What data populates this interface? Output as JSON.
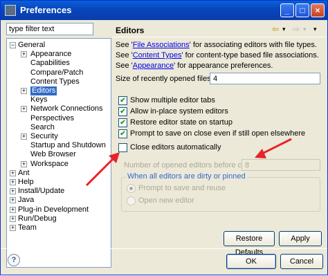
{
  "window": {
    "title": "Preferences",
    "minimize_glyph": "_",
    "maximize_glyph": "□",
    "close_glyph": "×"
  },
  "sidebar": {
    "filter_value": "type filter text",
    "tree": [
      {
        "label": "General",
        "expander": "−",
        "level": 0
      },
      {
        "label": "Appearance",
        "expander": "+",
        "level": 1
      },
      {
        "label": "Capabilities",
        "expander": "",
        "level": 1
      },
      {
        "label": "Compare/Patch",
        "expander": "",
        "level": 1
      },
      {
        "label": "Content Types",
        "expander": "",
        "level": 1
      },
      {
        "label": "Editors",
        "expander": "+",
        "level": 1,
        "selected": true
      },
      {
        "label": "Keys",
        "expander": "",
        "level": 1
      },
      {
        "label": "Network Connections",
        "expander": "+",
        "level": 1
      },
      {
        "label": "Perspectives",
        "expander": "",
        "level": 1
      },
      {
        "label": "Search",
        "expander": "",
        "level": 1
      },
      {
        "label": "Security",
        "expander": "+",
        "level": 1
      },
      {
        "label": "Startup and Shutdown",
        "expander": "",
        "level": 1
      },
      {
        "label": "Web Browser",
        "expander": "",
        "level": 1
      },
      {
        "label": "Workspace",
        "expander": "+",
        "level": 1
      },
      {
        "label": "Ant",
        "expander": "+",
        "level": 0
      },
      {
        "label": "Help",
        "expander": "+",
        "level": 0
      },
      {
        "label": "Install/Update",
        "expander": "+",
        "level": 0
      },
      {
        "label": "Java",
        "expander": "+",
        "level": 0
      },
      {
        "label": "Plug-in Development",
        "expander": "+",
        "level": 0
      },
      {
        "label": "Run/Debug",
        "expander": "+",
        "level": 0
      },
      {
        "label": "Team",
        "expander": "+",
        "level": 0
      }
    ]
  },
  "page": {
    "title": "Editors",
    "nav_back": "⇦",
    "nav_back_menu": "▾",
    "nav_fwd": "⇨",
    "nav_fwd_menu": "▾",
    "see1_pre": "See '",
    "see1_link": "File Associations",
    "see1_post": "' for associating editors with file types.",
    "see2_pre": "See '",
    "see2_link": "Content Types",
    "see2_post": "' for content-type based file associations.",
    "see3_pre": "See '",
    "see3_link": "Appearance",
    "see3_post": "' for appearance preferences.",
    "recent_label": "Size of recently opened files list:",
    "recent_value": "4",
    "checkboxes": [
      {
        "label": "Show multiple editor tabs",
        "checked": true,
        "mark": "✔"
      },
      {
        "label": "Allow in-place system editors",
        "checked": true,
        "mark": "✔"
      },
      {
        "label": "Restore editor state on startup",
        "checked": true,
        "mark": "✔"
      },
      {
        "label": "Prompt to save on close even if still open elsewhere",
        "checked": true,
        "mark": "✔"
      },
      {
        "label": "Close editors automatically",
        "checked": false,
        "mark": ""
      }
    ],
    "opened_label": "Number of opened editors before closing:",
    "opened_value": "8",
    "group_title": "When all editors are dirty or pinned",
    "radio_prompt": "Prompt to save and reuse",
    "radio_open": "Open new editor",
    "restore_defaults": "Restore Defaults",
    "apply": "Apply"
  },
  "footer": {
    "ok": "OK",
    "cancel": "Cancel",
    "help_glyph": "?"
  },
  "colors": {
    "selection": "#316ac5",
    "arrow": "#e8232a",
    "titlebar": "#0a5fd8",
    "link": "#0000ee"
  }
}
